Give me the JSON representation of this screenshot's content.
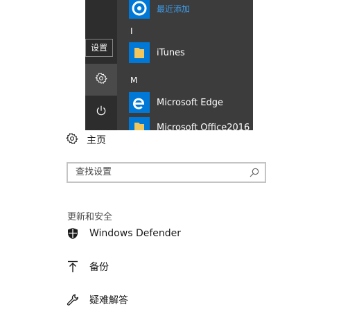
{
  "start_menu": {
    "tooltip": "设置",
    "rail": {
      "settings_icon": "gear-icon",
      "power_icon": "power-icon"
    },
    "apps": [
      {
        "label": "最近添加",
        "icon": "recent-app-icon",
        "highlight": true
      },
      {
        "letter": "I"
      },
      {
        "label": "iTunes",
        "icon": "folder-icon"
      },
      {
        "letter": "M"
      },
      {
        "label": "Microsoft Edge",
        "icon": "edge-icon"
      },
      {
        "label": "Microsoft Office2016",
        "icon": "folder-icon"
      }
    ]
  },
  "settings": {
    "home_label": "主页",
    "search_placeholder": "查找设置",
    "section_title": "更新和安全",
    "items": [
      {
        "label": "Windows Defender",
        "icon": "shield-icon"
      },
      {
        "label": "备份",
        "icon": "backup-icon"
      },
      {
        "label": "疑难解答",
        "icon": "wrench-icon"
      }
    ]
  },
  "colors": {
    "start_bg": "#3c3c3c",
    "rail_bg": "#2d2d2d",
    "accent": "#0078d7",
    "folder": "#f2c65b"
  }
}
